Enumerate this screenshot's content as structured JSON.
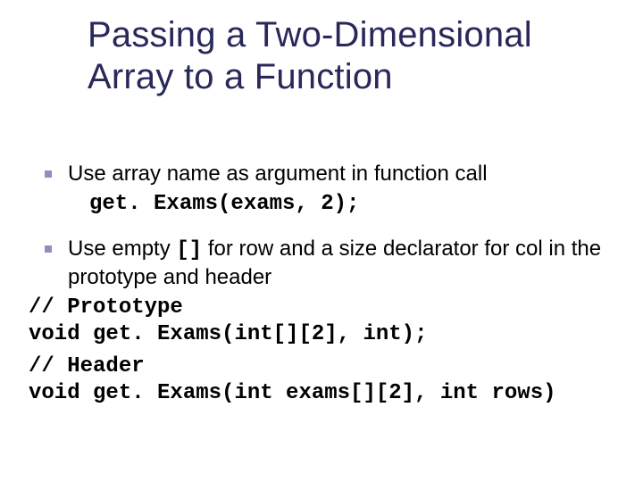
{
  "title": "Passing a Two-Dimensional Array to a Function",
  "bullets": [
    {
      "text": "Use array name as argument in function call",
      "code": "get. Exams(exams, 2);"
    },
    {
      "pre": "Use empty ",
      "mono": "[]",
      "post": " for row and a size declarator for col in the prototype and header"
    }
  ],
  "code": {
    "c1": "// Prototype",
    "c2": "void get. Exams(int[][2], int);",
    "c3": "// Header",
    "c4": "void get. Exams(int exams[][2], int rows)"
  }
}
